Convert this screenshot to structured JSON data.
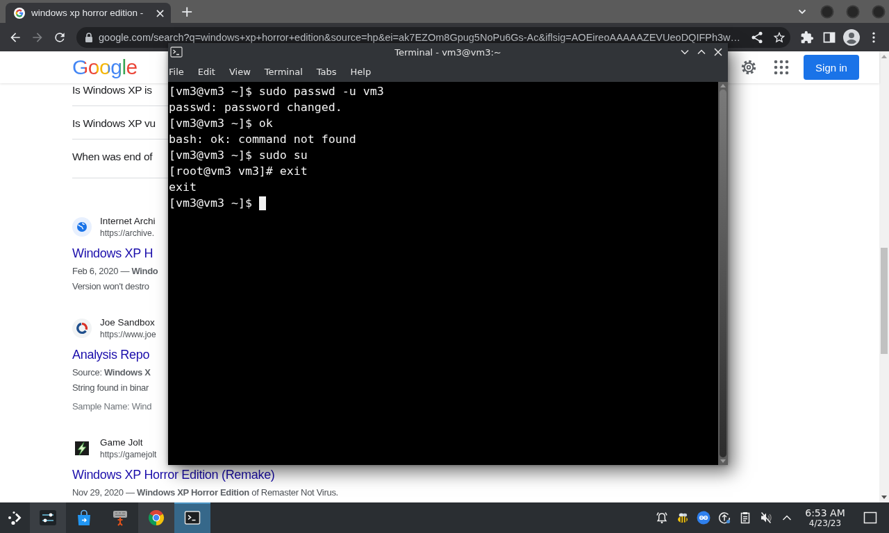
{
  "browser": {
    "tabs": [
      {
        "title": "windows xp horror edition -",
        "close": "×",
        "selected": true
      }
    ],
    "new_tab": "+",
    "forward_disabled": true,
    "address": "google.com/search?q=windows+xp+horror+edition&source=hp&ei=ak7EZOm8Gpug5NoPu6Gs-Ac&iflsig=AOEireoAAAAAZEVUeoDQIFPh3w…"
  },
  "google": {
    "logo": "Google",
    "sign_in": "Sign in",
    "questions": [
      "Is Windows XP is",
      "Is Windows XP vu",
      "When was end of"
    ],
    "results": [
      {
        "site": "Internet Archi",
        "url": "https://archive.",
        "title": "Windows XP H",
        "lines": [
          {
            "kind": "text",
            "text": "Feb 6, 2020 — **Windo**"
          },
          {
            "kind": "text",
            "text": "Version won't destro"
          }
        ]
      },
      {
        "site": "Joe Sandbox",
        "url": "https://www.joe",
        "title": "Analysis Repo",
        "lines": [
          {
            "kind": "text",
            "text": "Source: **Windows X**"
          },
          {
            "kind": "text",
            "text": "String found in binar"
          },
          {
            "kind": "meta",
            "text": "Sample Name: Wind"
          }
        ]
      },
      {
        "site": "Game Jolt",
        "url": "https://gamejolt",
        "title": "Windows XP Horror Edition (Remake)",
        "lines": [
          {
            "kind": "text",
            "text": "Nov 29, 2020 — **Windows XP Horror Edition** of Remaster Not Virus."
          }
        ]
      }
    ]
  },
  "terminal": {
    "title": "Terminal - vm3@vm3:~",
    "menu": [
      "File",
      "Edit",
      "View",
      "Terminal",
      "Tabs",
      "Help"
    ],
    "lines": [
      "[vm3@vm3 ~]$ sudo passwd -u vm3",
      "passwd: password changed.",
      "[vm3@vm3 ~]$ ok",
      "bash: ok: command not found",
      "[vm3@vm3 ~]$ sudo su",
      "[root@vm3 vm3]# exit",
      "exit",
      "[vm3@vm3 ~]$"
    ]
  },
  "taskbar": {
    "apps": [
      {
        "running": true,
        "selected": false
      },
      {
        "running": false,
        "selected": false
      },
      {
        "running": false,
        "selected": false
      },
      {
        "running": true,
        "selected": false
      },
      {
        "running": true,
        "selected": true
      }
    ],
    "time": "6:53 AM",
    "date": "4/23/23"
  }
}
